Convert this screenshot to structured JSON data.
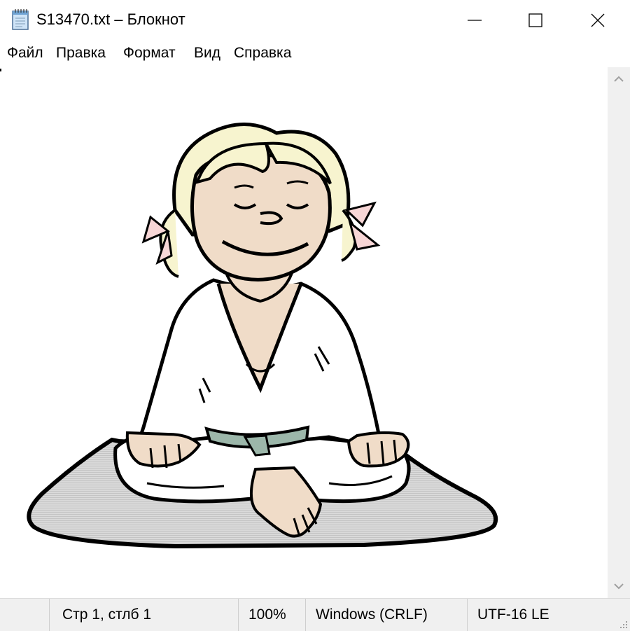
{
  "window": {
    "title": "S13470.txt – Блокнот",
    "controls": {
      "minimize": "minimize",
      "maximize": "maximize",
      "close": "close"
    }
  },
  "menu": {
    "items": [
      {
        "label": "Файл"
      },
      {
        "label": "Правка"
      },
      {
        "label": "Формат"
      },
      {
        "label": "Вид"
      },
      {
        "label": "Справка"
      }
    ]
  },
  "editor": {
    "content_image": "meditating-girl-clipart"
  },
  "status": {
    "position": "Стр 1, стлб 1",
    "zoom": "100%",
    "line_endings": "Windows (CRLF)",
    "encoding": "UTF-16 LE"
  },
  "colors": {
    "chrome": "#ffffff",
    "statusbar": "#f0f0f0",
    "hair": "#f7f4cf",
    "skin": "#f0dcc8",
    "belt": "#9cb7aa",
    "mat": "#e3e3e3",
    "bow": "#f7d6d6"
  }
}
